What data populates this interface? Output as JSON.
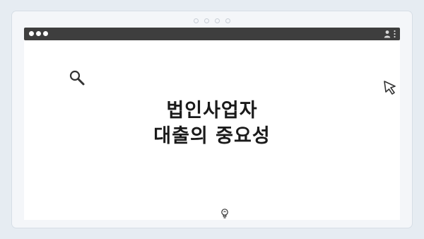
{
  "window": {
    "icons": [
      "user-icon",
      "kebab-menu-icon",
      "search-icon",
      "cursor-icon",
      "lightbulb-icon"
    ]
  },
  "slide": {
    "title_line1": "법인사업자",
    "title_line2": "대출의 중요성"
  }
}
